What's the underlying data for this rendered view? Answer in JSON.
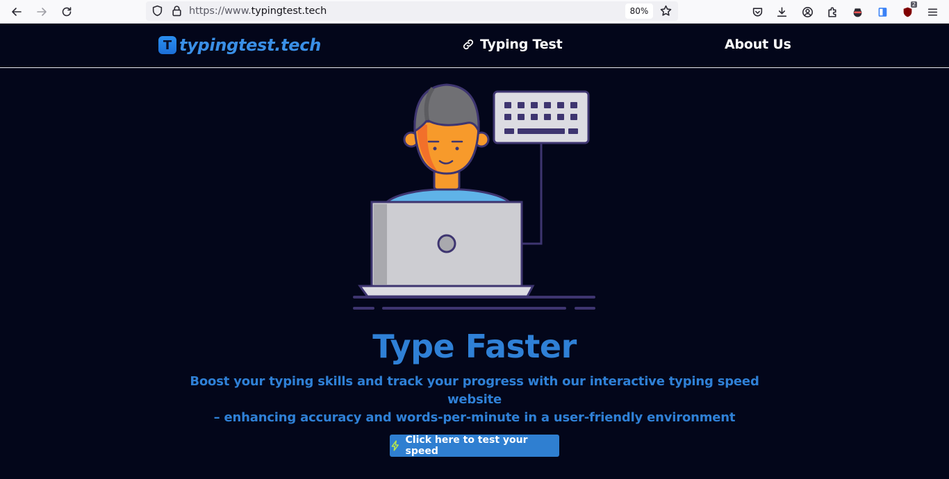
{
  "browser": {
    "url_prefix": "https://www.",
    "url_domain": "typingtest.tech",
    "zoom": "80%",
    "extension_badge": "2"
  },
  "header": {
    "logo_letter": "T",
    "logo_text": "typingtest.tech",
    "nav": [
      {
        "label": "Typing Test",
        "icon": "link-icon"
      },
      {
        "label": "About Us"
      }
    ]
  },
  "hero": {
    "title": "Type Faster",
    "subtitle_line1": "Boost your typing skills and track your progress with our interactive typing speed website",
    "subtitle_line2": "– enhancing accuracy and words-per-minute in a user-friendly environment",
    "cta_label": "Click here to test your speed",
    "cta_icon": "lightning-icon"
  },
  "colors": {
    "page_bg": "#03061a",
    "accent": "#2f80d6",
    "cta_bg": "#2f7fd1",
    "cta_icon": "#b9e84a"
  }
}
